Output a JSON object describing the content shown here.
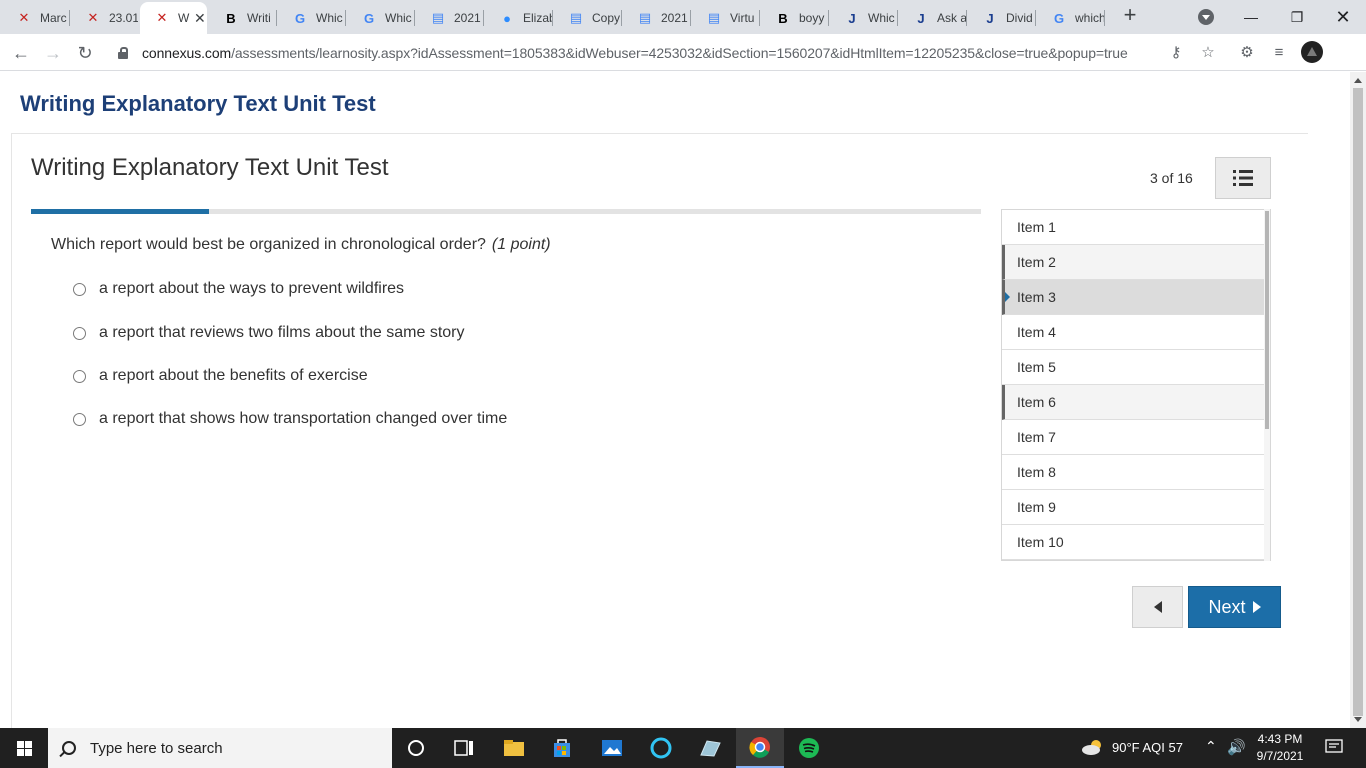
{
  "browser": {
    "tabs": [
      {
        "title": "Marc",
        "icon": "connexus-icon"
      },
      {
        "title": "23.01",
        "icon": "connexus-icon"
      },
      {
        "title": "W",
        "icon": "connexus-icon",
        "active": true
      },
      {
        "title": "Writi",
        "icon": "brainly-icon"
      },
      {
        "title": "Whic",
        "icon": "google-icon"
      },
      {
        "title": "Whic",
        "icon": "google-icon"
      },
      {
        "title": "2021",
        "icon": "docs-icon"
      },
      {
        "title": "Elizab",
        "icon": "zoom-icon"
      },
      {
        "title": "Copy",
        "icon": "docs-icon"
      },
      {
        "title": "2021",
        "icon": "docs-icon"
      },
      {
        "title": "Virtu",
        "icon": "docs-icon"
      },
      {
        "title": "boyy",
        "icon": "brainly-icon"
      },
      {
        "title": "Whic",
        "icon": "jiskha-icon"
      },
      {
        "title": "Ask a",
        "icon": "jiskha-icon"
      },
      {
        "title": "Divid",
        "icon": "jiskha-icon"
      },
      {
        "title": "which",
        "icon": "google-icon"
      }
    ],
    "url_host": "connexus.com",
    "url_path": "/assessments/learnosity.aspx?idAssessment=1805383&idWebuser=4253032&idSection=1560207&idHtmlItem=12205235&close=true&popup=true"
  },
  "page": {
    "header": "Writing Explanatory Text Unit Test"
  },
  "test": {
    "title": "Writing Explanatory Text Unit Test",
    "counter": "3 of 16",
    "progress_fraction": 0.1875,
    "question": "Which report would best be organized in chronological order?",
    "points": "(1 point)",
    "options": [
      "a report about the ways to prevent wildfires",
      "a report that reviews two films about the same story",
      "a report about the benefits of exercise",
      "a report that shows how transportation changed over time"
    ],
    "items": [
      {
        "label": "Item 1",
        "state": "normal"
      },
      {
        "label": "Item 2",
        "state": "visited"
      },
      {
        "label": "Item 3",
        "state": "current"
      },
      {
        "label": "Item 4",
        "state": "normal"
      },
      {
        "label": "Item 5",
        "state": "normal"
      },
      {
        "label": "Item 6",
        "state": "visited"
      },
      {
        "label": "Item 7",
        "state": "normal"
      },
      {
        "label": "Item 8",
        "state": "normal"
      },
      {
        "label": "Item 9",
        "state": "normal"
      },
      {
        "label": "Item 10",
        "state": "normal"
      }
    ],
    "next_label": "Next"
  },
  "taskbar": {
    "search_placeholder": "Type here to search",
    "weather": "90°F  AQI 57",
    "time": "4:43 PM",
    "date": "9/7/2021"
  },
  "colors": {
    "accent": "#1c6ea8",
    "header_blue": "#1d3f77",
    "progress": "#1f6fa5"
  }
}
